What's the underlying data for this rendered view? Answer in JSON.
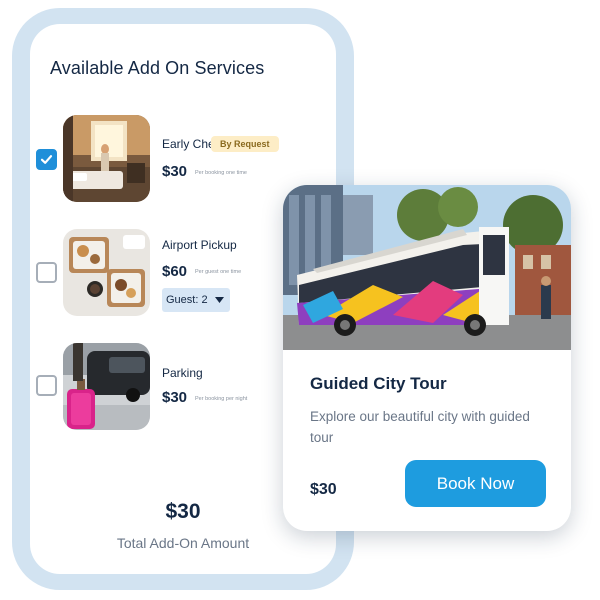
{
  "addons": {
    "title": "Available Add On Services",
    "items": [
      {
        "name": "Early Check-In",
        "badge": "By Request",
        "price": "$30",
        "note": "Per booking one time",
        "checked": true
      },
      {
        "name": "Airport Pickup",
        "price": "$60",
        "note": "Per guest one time",
        "guest_select": "Guest: 2",
        "checked": false
      },
      {
        "name": "Parking",
        "price": "$30",
        "note": "Per booking per night",
        "checked": false
      }
    ],
    "total_amount": "$30",
    "total_label": "Total Add-On Amount"
  },
  "tour": {
    "title": "Guided City Tour",
    "description": "Explore our beautiful city with guided tour",
    "price": "$30",
    "book_label": "Book Now"
  },
  "colors": {
    "accent": "#1e9cdf",
    "frame": "#d2e3f1",
    "badge_bg": "#fdedc6"
  }
}
